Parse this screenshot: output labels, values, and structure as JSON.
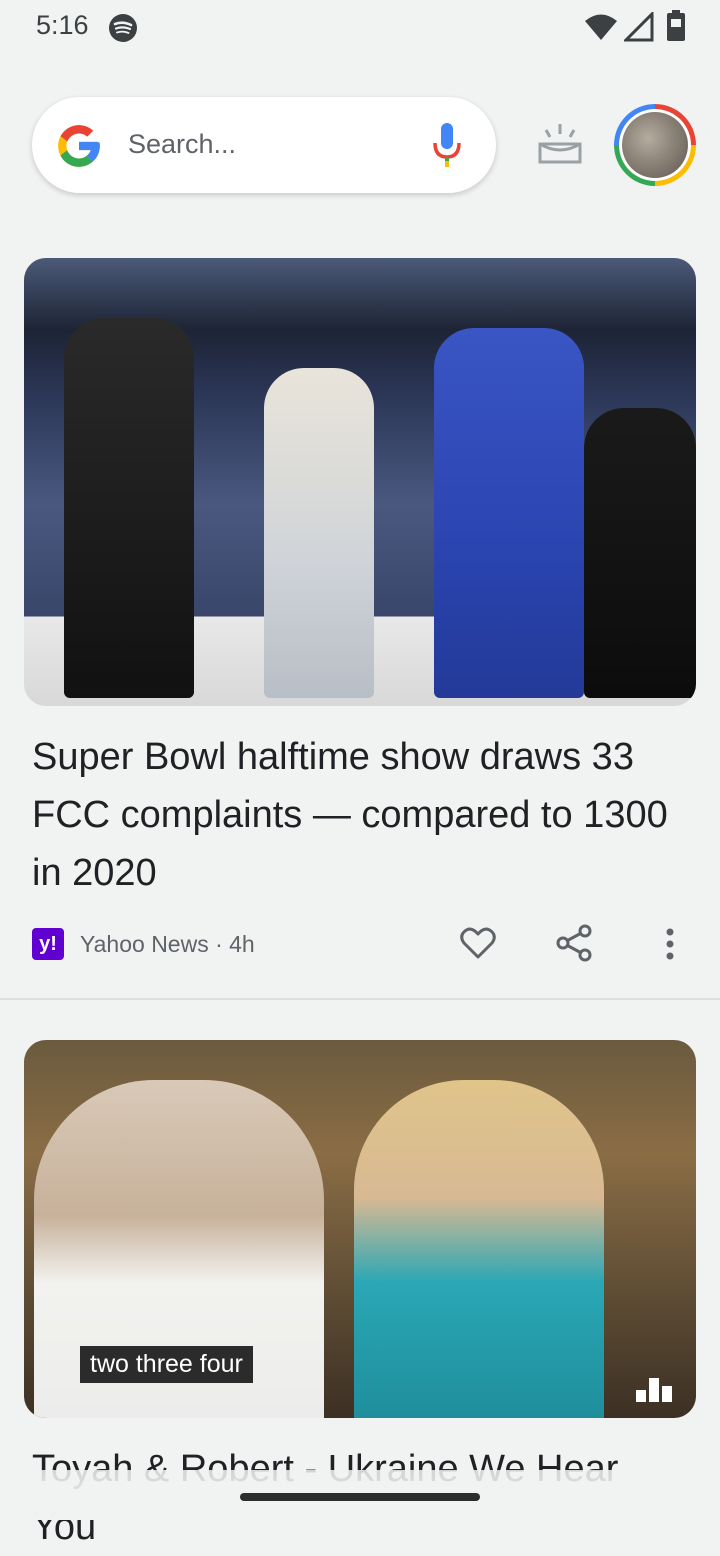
{
  "status_bar": {
    "time": "5:16",
    "icons": [
      "spotify-icon",
      "wifi-icon",
      "signal-icon",
      "battery-icon"
    ]
  },
  "search": {
    "placeholder": "Search...",
    "icons": [
      "google-icon",
      "mic-icon"
    ]
  },
  "header_actions": [
    "snapshot-icon",
    "avatar"
  ],
  "feed": [
    {
      "headline": "Super Bowl halftime show draws 33 FCC complaints — compared to 1300 in 2020",
      "source": "Yahoo News",
      "age": "4h",
      "source_meta": "Yahoo News · 4h",
      "source_logo": "y!",
      "actions": [
        "like-icon",
        "share-icon",
        "more-icon"
      ]
    },
    {
      "headline": "Toyah & Robert - Ukraine We Hear You",
      "video_caption": "two three four"
    }
  ],
  "colors": {
    "google_blue": "#4285f4",
    "google_red": "#ea4335",
    "google_yellow": "#fbbc05",
    "google_green": "#34a853",
    "yahoo_purple": "#6001d2"
  }
}
